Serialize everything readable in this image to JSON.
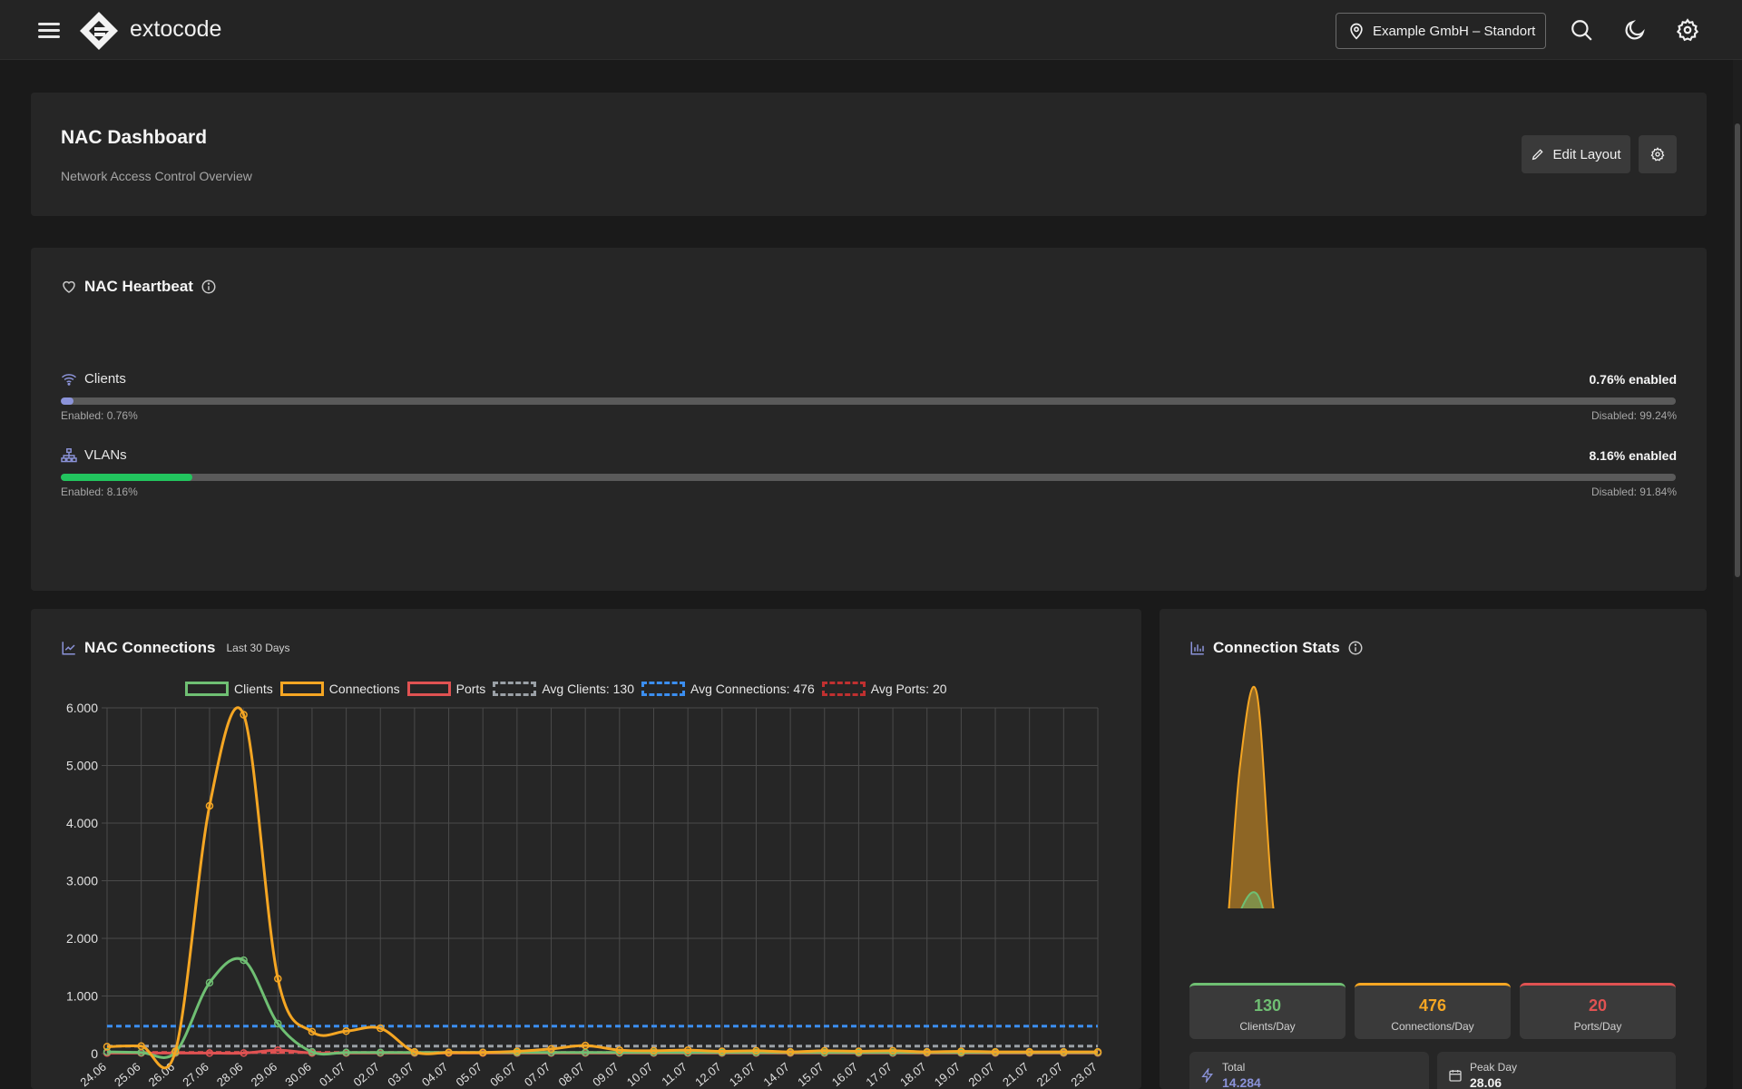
{
  "topbar": {
    "brand": "extocode",
    "site": "Example GmbH – Standort"
  },
  "header": {
    "title": "NAC Dashboard",
    "subtitle": "Network Access Control Overview",
    "edit_layout": "Edit Layout"
  },
  "heartbeat": {
    "title": "NAC Heartbeat",
    "rows": [
      {
        "label": "Clients",
        "pct_label": "0.76% enabled",
        "enabled_label": "Enabled: 0.76%",
        "disabled_label": "Disabled: 99.24%",
        "fraction": 0.0076,
        "color": "#8b93d9"
      },
      {
        "label": "VLANs",
        "pct_label": "8.16% enabled",
        "enabled_label": "Enabled: 8.16%",
        "disabled_label": "Disabled: 91.84%",
        "fraction": 0.0816,
        "color": "#22c55e"
      }
    ]
  },
  "connections": {
    "title": "NAC Connections",
    "range": "Last 30 Days",
    "legend": {
      "clients": "Clients",
      "connections": "Connections",
      "ports": "Ports",
      "avg_clients": "Avg Clients: 130",
      "avg_connections": "Avg Connections: 476",
      "avg_ports": "Avg Ports: 20"
    }
  },
  "stats": {
    "title": "Connection Stats",
    "clients_day": "130",
    "clients_day_label": "Clients/Day",
    "connections_day": "476",
    "connections_day_label": "Connections/Day",
    "ports_day": "20",
    "ports_day_label": "Ports/Day",
    "total_label": "Total",
    "total_value": "14.284",
    "peak_label": "Peak Day",
    "peak_value": "28.06"
  },
  "chart_data": {
    "type": "line",
    "categories": [
      "24.06",
      "25.06",
      "26.06",
      "27.06",
      "28.06",
      "29.06",
      "30.06",
      "01.07",
      "02.07",
      "03.07",
      "04.07",
      "05.07",
      "06.07",
      "07.07",
      "08.07",
      "09.07",
      "10.07",
      "11.07",
      "12.07",
      "13.07",
      "14.07",
      "15.07",
      "16.07",
      "17.07",
      "18.07",
      "19.07",
      "20.07",
      "21.07",
      "22.07",
      "23.07"
    ],
    "y_ticks": [
      "0",
      "1.000",
      "2.000",
      "3.000",
      "4.000",
      "5.000",
      "6.000"
    ],
    "ylim": [
      0,
      6000
    ],
    "grid": true,
    "legend_position": "top",
    "series": [
      {
        "name": "Clients",
        "color": "#6fbf73",
        "values": [
          30,
          20,
          20,
          1230,
          1620,
          520,
          30,
          20,
          20,
          20,
          20,
          20,
          20,
          20,
          20,
          20,
          20,
          20,
          20,
          20,
          20,
          20,
          20,
          20,
          20,
          20,
          20,
          20,
          20,
          20
        ]
      },
      {
        "name": "Connections",
        "color": "#f5a623",
        "values": [
          120,
          130,
          40,
          4300,
          5880,
          1300,
          380,
          390,
          440,
          30,
          20,
          20,
          40,
          80,
          140,
          60,
          50,
          60,
          40,
          50,
          30,
          50,
          40,
          50,
          30,
          40,
          30,
          30,
          30,
          30
        ]
      },
      {
        "name": "Ports",
        "color": "#e05252",
        "values": [
          10,
          10,
          10,
          10,
          10,
          60,
          10,
          10,
          10,
          10,
          10,
          10,
          10,
          10,
          10,
          10,
          10,
          10,
          10,
          10,
          10,
          10,
          10,
          10,
          10,
          10,
          10,
          10,
          10,
          10
        ]
      }
    ],
    "averages": [
      {
        "name": "Avg Clients: 130",
        "value": 130,
        "color": "#9aa0a6"
      },
      {
        "name": "Avg Connections: 476",
        "value": 476,
        "color": "#3b8ef0"
      },
      {
        "name": "Avg Ports: 20",
        "value": 20,
        "color": "#e05252"
      }
    ]
  }
}
